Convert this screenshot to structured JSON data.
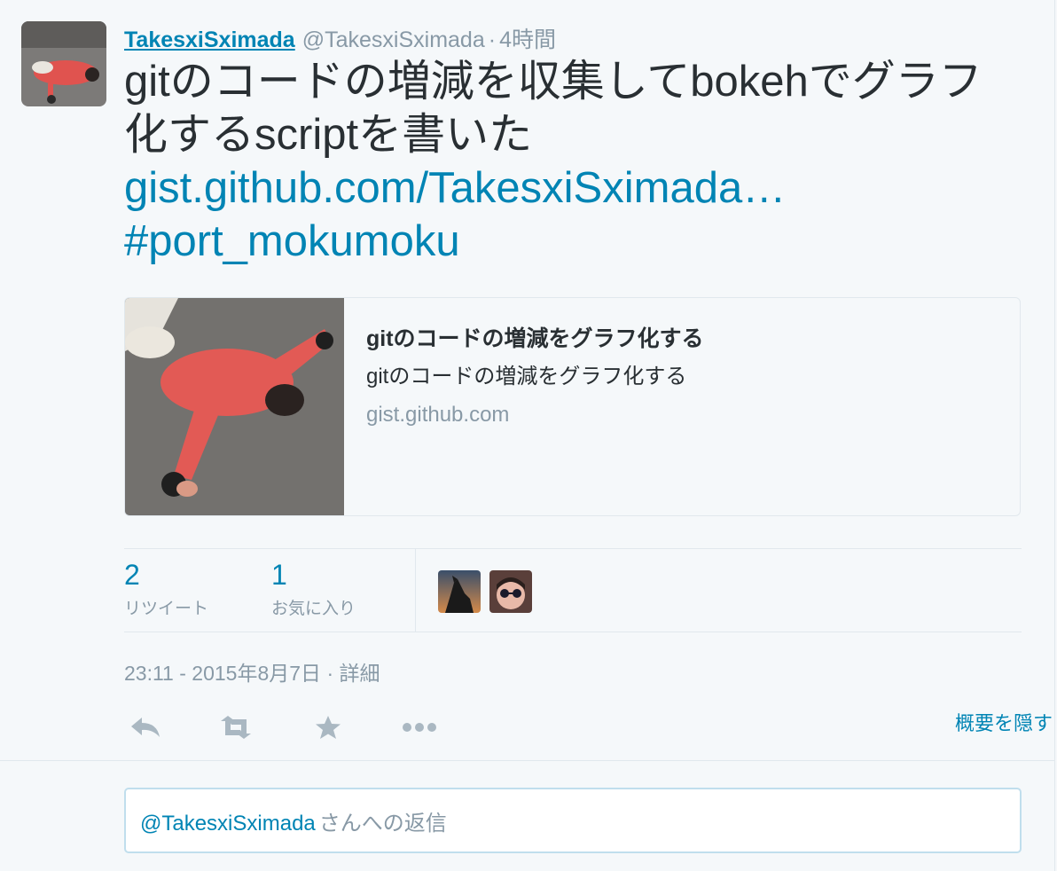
{
  "tweet": {
    "fullname": "TakesxiSximada",
    "screen_name": "@TakesxiSximada",
    "separator": "·",
    "time": "4時間",
    "text": "gitのコードの増減を収集してbokehでグラフ化するscriptを書いた",
    "link": "gist.github.com/TakesxiSximada…",
    "hashtag": "#port_mokumoku"
  },
  "card": {
    "title": "gitのコードの増減をグラフ化する",
    "description": "gitのコードの増減をグラフ化する",
    "domain": "gist.github.com"
  },
  "stats": {
    "retweets": {
      "count": "2",
      "label": "リツイート"
    },
    "favorites": {
      "count": "1",
      "label": "お気に入り"
    }
  },
  "meta": {
    "timestamp": "23:11 - 2015年8月7日",
    "separator": "·",
    "details": "詳細"
  },
  "actions": {
    "reply_icon": "reply-icon",
    "retweet_icon": "retweet-icon",
    "favorite_icon": "star-icon",
    "more_icon": "more-icon",
    "collapse_label": "概要を隠す"
  },
  "reply": {
    "mention": "@TakesxiSximada",
    "placeholder": "さんへの返信"
  },
  "colors": {
    "link": "#0084b4",
    "muted": "#8899a6",
    "text": "#292f33",
    "background": "#f5f8fa",
    "border": "#e1e8ed"
  }
}
